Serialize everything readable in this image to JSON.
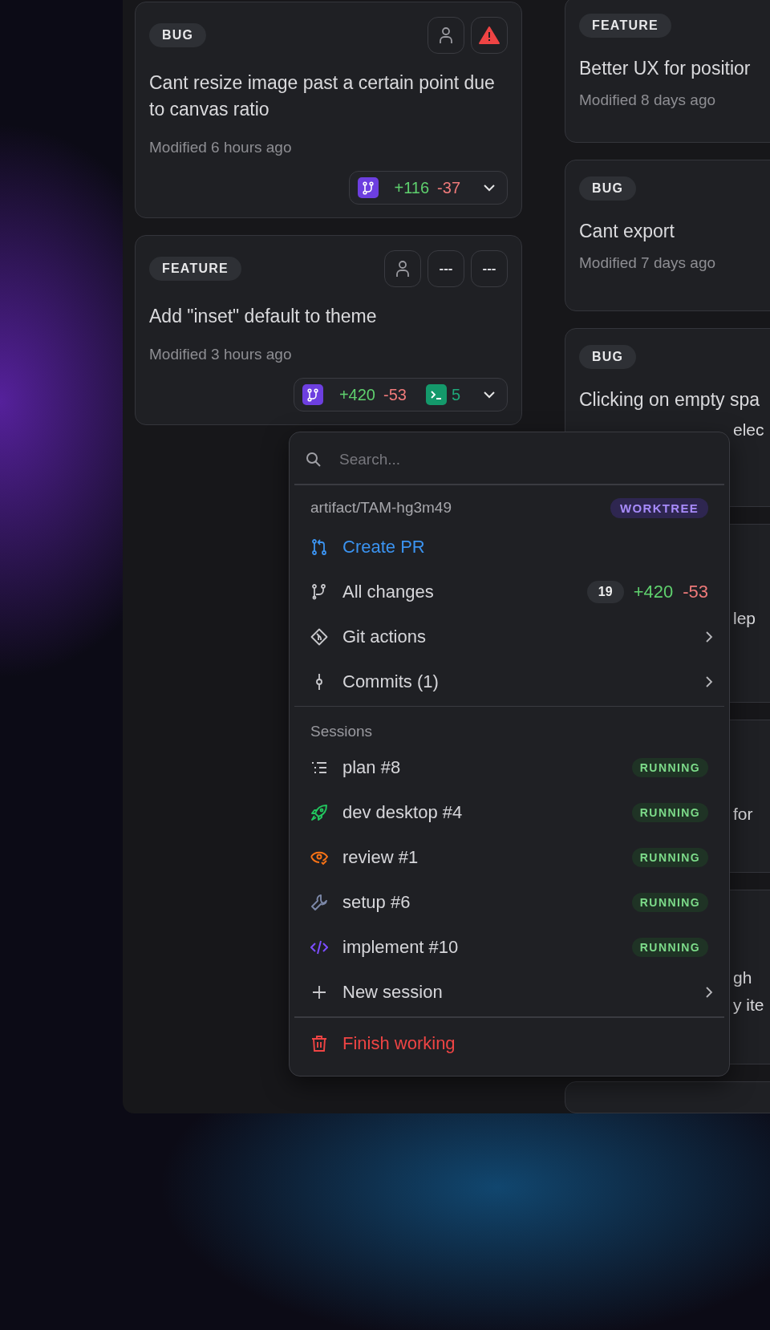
{
  "columns": [
    {
      "cards": [
        {
          "tag": "BUG",
          "title": "Cant resize image past a certain point due to canvas ratio",
          "modified": "Modified 6 hours ago",
          "actions": [
            {
              "kind": "assignee"
            },
            {
              "kind": "alert"
            }
          ],
          "diff": {
            "added": "+116",
            "removed": "-37"
          }
        },
        {
          "tag": "FEATURE",
          "title": "Add \"inset\" default to theme",
          "modified": "Modified 3 hours ago",
          "actions": [
            {
              "kind": "assignee"
            },
            {
              "kind": "text",
              "label": "---"
            },
            {
              "kind": "text",
              "label": "---"
            }
          ],
          "diff": {
            "added": "+420",
            "removed": "-53",
            "sessions": "5"
          }
        }
      ]
    },
    {
      "cards": [
        {
          "tag": "FEATURE",
          "title": "Better UX for positior",
          "modified": "Modified 8 days ago"
        },
        {
          "tag": "BUG",
          "title": "Cant export",
          "modified": "Modified 7 days ago"
        },
        {
          "tag": "BUG",
          "title": "Clicking on empty spa",
          "fragments": [
            "elec"
          ]
        },
        {
          "fragments": [
            "lep"
          ]
        },
        {
          "fragments": [
            "for"
          ]
        },
        {
          "fragments": [
            "gh",
            "y ite"
          ]
        }
      ]
    }
  ],
  "menu": {
    "search": {
      "placeholder": "Search..."
    },
    "branch": "artifact/TAM-hg3m49",
    "branch_badge": "WORKTREE",
    "items": [
      {
        "kind": "pr",
        "label": "Create PR",
        "submenu": false
      },
      {
        "kind": "changes",
        "label": "All changes",
        "count": "19",
        "added": "+420",
        "removed": "-53",
        "submenu": false
      },
      {
        "kind": "git",
        "label": "Git actions",
        "submenu": true
      },
      {
        "kind": "commits",
        "label": "Commits (1)",
        "submenu": true
      }
    ],
    "sessions_heading": "Sessions",
    "sessions": [
      {
        "kind": "plan",
        "label": "plan #8",
        "status": "RUNNING"
      },
      {
        "kind": "dev",
        "label": "dev desktop #4",
        "status": "RUNNING"
      },
      {
        "kind": "review",
        "label": "review #1",
        "status": "RUNNING"
      },
      {
        "kind": "setup",
        "label": "setup #6",
        "status": "RUNNING"
      },
      {
        "kind": "implement",
        "label": "implement #10",
        "status": "RUNNING"
      }
    ],
    "new_session": {
      "label": "New session",
      "submenu": true
    },
    "finish": {
      "label": "Finish working"
    }
  }
}
